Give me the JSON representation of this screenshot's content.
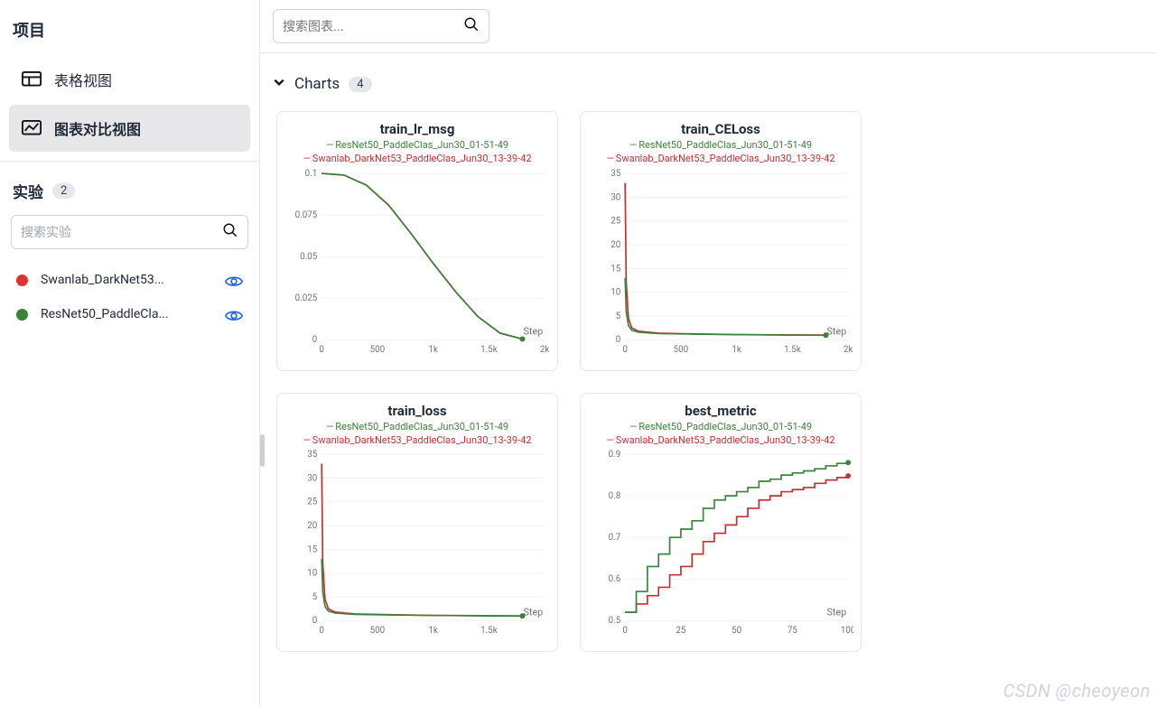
{
  "sidebar": {
    "project_title": "项目",
    "items": [
      {
        "label": "表格视图",
        "active": false
      },
      {
        "label": "图表对比视图",
        "active": true
      }
    ],
    "experiments_title": "实验",
    "experiments_count": "2",
    "search_placeholder": "搜索实验",
    "experiments": [
      {
        "label": "Swanlab_DarkNet53...",
        "color": "#e03131"
      },
      {
        "label": "ResNet50_PaddleCla...",
        "color": "#3a833a"
      }
    ]
  },
  "top_search_placeholder": "搜索图表...",
  "section": {
    "title": "Charts",
    "count": "4"
  },
  "series_meta": {
    "s1": {
      "name": "ResNet50_PaddleClas_Jun30_01-51-49",
      "color": "#3a833a"
    },
    "s2": {
      "name": "Swanlab_DarkNet53_PaddleClas_Jun30_13-39-42",
      "color": "#c23030"
    }
  },
  "watermark": "CSDN @cheoyeon",
  "chart_data": [
    {
      "id": "train_lr_msg",
      "type": "line",
      "title": "train_lr_msg",
      "xlabel": "Step",
      "ylabel": "",
      "xlim": [
        0,
        2000
      ],
      "ylim": [
        0,
        0.1
      ],
      "xticks": [
        0,
        500,
        1000,
        1500,
        2000
      ],
      "xtick_labels": [
        "0",
        "500",
        "1k",
        "1.5k",
        "2k"
      ],
      "yticks": [
        0,
        0.025,
        0.05,
        0.075,
        0.1
      ],
      "series": [
        {
          "ref": "s1",
          "x": [
            0,
            200,
            400,
            600,
            800,
            1000,
            1200,
            1400,
            1600,
            1800
          ],
          "y": [
            0.1,
            0.099,
            0.093,
            0.081,
            0.064,
            0.046,
            0.029,
            0.014,
            0.004,
            0.0005
          ]
        },
        {
          "ref": "s2",
          "x": [
            0,
            200,
            400,
            600,
            800,
            1000,
            1200,
            1400,
            1600,
            1800
          ],
          "y": [
            0.1,
            0.099,
            0.093,
            0.081,
            0.064,
            0.046,
            0.029,
            0.014,
            0.004,
            0.0005
          ]
        }
      ]
    },
    {
      "id": "train_CELoss",
      "type": "line",
      "title": "train_CELoss",
      "xlabel": "Step",
      "ylabel": "",
      "xlim": [
        0,
        2000
      ],
      "ylim": [
        0,
        35
      ],
      "xticks": [
        0,
        500,
        1000,
        1500,
        2000
      ],
      "xtick_labels": [
        "0",
        "500",
        "1k",
        "1.5k",
        "2k"
      ],
      "yticks": [
        0,
        5,
        10,
        15,
        20,
        25,
        30,
        35
      ],
      "series": [
        {
          "ref": "s1",
          "x": [
            0,
            10,
            30,
            60,
            120,
            300,
            600,
            1000,
            1400,
            1800
          ],
          "y": [
            13,
            6,
            3.0,
            2.0,
            1.6,
            1.3,
            1.2,
            1.1,
            1.0,
            0.95
          ]
        },
        {
          "ref": "s2",
          "x": [
            0,
            10,
            30,
            60,
            120,
            300,
            600,
            1000,
            1400,
            1800
          ],
          "y": [
            33,
            12,
            4.5,
            2.5,
            1.8,
            1.4,
            1.25,
            1.1,
            1.05,
            1.0
          ]
        }
      ]
    },
    {
      "id": "train_loss",
      "type": "line",
      "title": "train_loss",
      "xlabel": "Step",
      "ylabel": "",
      "xlim": [
        0,
        2000
      ],
      "ylim": [
        0,
        35
      ],
      "xticks": [
        0,
        500,
        1000,
        1500
      ],
      "xtick_labels": [
        "0",
        "500",
        "1k",
        "1.5k"
      ],
      "yticks": [
        0,
        5,
        10,
        15,
        20,
        25,
        30,
        35
      ],
      "clip_right": true,
      "series": [
        {
          "ref": "s1",
          "x": [
            0,
            10,
            30,
            60,
            120,
            300,
            600,
            1000,
            1400,
            1800
          ],
          "y": [
            13,
            6,
            3.0,
            2.0,
            1.6,
            1.3,
            1.2,
            1.1,
            1.0,
            0.95
          ]
        },
        {
          "ref": "s2",
          "x": [
            0,
            10,
            30,
            60,
            120,
            300,
            600,
            1000,
            1400,
            1800
          ],
          "y": [
            33,
            12,
            4.5,
            2.5,
            1.8,
            1.4,
            1.25,
            1.1,
            1.05,
            1.0
          ]
        }
      ]
    },
    {
      "id": "best_metric",
      "type": "line",
      "title": "best_metric",
      "xlabel": "Step",
      "ylabel": "",
      "xlim": [
        0,
        100
      ],
      "ylim": [
        0.5,
        0.9
      ],
      "xticks": [
        0,
        25,
        50,
        75,
        100
      ],
      "xtick_labels": [
        "0",
        "25",
        "50",
        "75",
        "100"
      ],
      "yticks": [
        0.5,
        0.6,
        0.7,
        0.8,
        0.9
      ],
      "step": true,
      "series": [
        {
          "ref": "s1",
          "x": [
            0,
            5,
            10,
            15,
            20,
            25,
            30,
            35,
            40,
            45,
            50,
            55,
            60,
            65,
            70,
            75,
            80,
            85,
            90,
            95,
            100
          ],
          "y": [
            0.52,
            0.57,
            0.63,
            0.66,
            0.7,
            0.72,
            0.74,
            0.77,
            0.79,
            0.8,
            0.81,
            0.82,
            0.835,
            0.84,
            0.85,
            0.855,
            0.86,
            0.865,
            0.872,
            0.878,
            0.88
          ]
        },
        {
          "ref": "s2",
          "x": [
            0,
            5,
            10,
            15,
            20,
            25,
            30,
            35,
            40,
            45,
            50,
            55,
            60,
            65,
            70,
            75,
            80,
            85,
            90,
            95,
            100
          ],
          "y": [
            0.52,
            0.54,
            0.56,
            0.58,
            0.61,
            0.63,
            0.66,
            0.69,
            0.71,
            0.73,
            0.75,
            0.77,
            0.79,
            0.8,
            0.81,
            0.815,
            0.82,
            0.83,
            0.838,
            0.844,
            0.848
          ]
        }
      ]
    }
  ]
}
